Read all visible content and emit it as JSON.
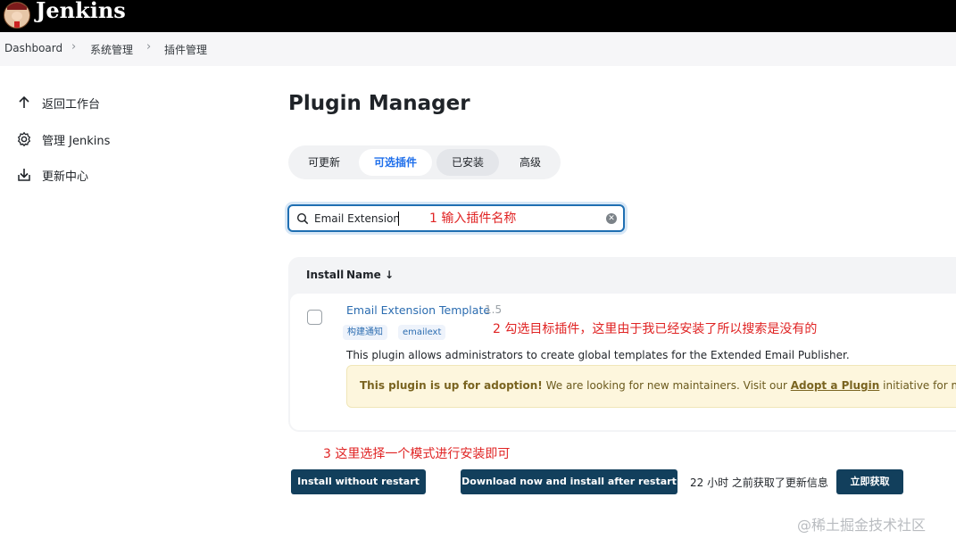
{
  "app": {
    "brand": "Jenkins"
  },
  "breadcrumb": [
    {
      "label": "Dashboard"
    },
    {
      "label": "系统管理"
    },
    {
      "label": "插件管理"
    }
  ],
  "sidebar": {
    "items": [
      {
        "label": "返回工作台",
        "icon": "arrow-up-icon"
      },
      {
        "label": "管理 Jenkins",
        "icon": "gear-icon"
      },
      {
        "label": "更新中心",
        "icon": "download-icon"
      }
    ]
  },
  "page": {
    "title": "Plugin Manager"
  },
  "tabs": [
    {
      "label": "可更新",
      "state": "normal"
    },
    {
      "label": "可选插件",
      "state": "active"
    },
    {
      "label": "已安装",
      "state": "hover"
    },
    {
      "label": "高级",
      "state": "normal"
    }
  ],
  "search": {
    "value": "Email Extension"
  },
  "annotations": {
    "step1": "1 输入插件名称",
    "step2": "2 勾选目标插件，这里由于我已经安装了所以搜索是没有的",
    "step3": "3 这里选择一个模式进行安装即可"
  },
  "table": {
    "headers": {
      "install": "Install",
      "name": "Name ↓"
    },
    "rows": [
      {
        "name": "Email Extension Template",
        "version": "1.5",
        "checked": false,
        "tags": [
          "构建通知",
          "emailext"
        ],
        "description": "This plugin allows administrators to create global templates for the Extended Email Publisher.",
        "adoption": {
          "bold": "This plugin is up for adoption!",
          "text": " We are looking for new maintainers. Visit our ",
          "link": "Adopt a Plugin",
          "tail": " initiative for more int"
        }
      }
    ]
  },
  "actions": {
    "install_without_restart": "Install without restart",
    "download_install_after_restart": "Download now and install after restart",
    "status": "22 小时 之前获取了更新信息",
    "check_now": "立即获取"
  },
  "watermark": "@稀土掘金技术社区",
  "colors": {
    "topbar": "#000000",
    "accent": "#1f6feb",
    "button": "#123f5c",
    "annotation": "#e02424",
    "adoption_bg": "#fdf6dd"
  }
}
